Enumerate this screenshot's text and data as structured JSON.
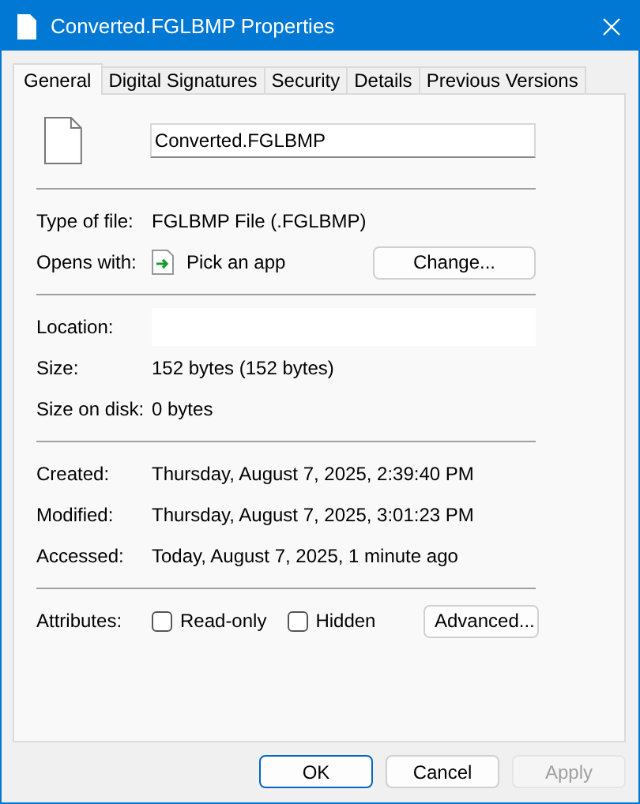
{
  "window": {
    "title": "Converted.FGLBMP Properties"
  },
  "tabs": [
    {
      "label": "General",
      "selected": true
    },
    {
      "label": "Digital Signatures",
      "selected": false
    },
    {
      "label": "Security",
      "selected": false
    },
    {
      "label": "Details",
      "selected": false
    },
    {
      "label": "Previous Versions",
      "selected": false
    }
  ],
  "file_name": "Converted.FGLBMP",
  "sections": [
    [
      {
        "kind": "text",
        "label": "Type of file:",
        "value": "FGLBMP File (.FGLBMP)"
      },
      {
        "kind": "app",
        "label": "Opens with:",
        "value": "Pick an app",
        "button": "Change..."
      }
    ],
    [
      {
        "kind": "blank",
        "label": "Location:"
      },
      {
        "kind": "text",
        "label": "Size:",
        "value": "152 bytes (152 bytes)"
      },
      {
        "kind": "text",
        "label": "Size on disk:",
        "value": "0 bytes"
      }
    ],
    [
      {
        "kind": "text",
        "label": "Created:",
        "value": "Thursday, August 7, 2025, 2:39:40 PM"
      },
      {
        "kind": "text",
        "label": "Modified:",
        "value": "Thursday, August 7, 2025, 3:01:23 PM"
      },
      {
        "kind": "text",
        "label": "Accessed:",
        "value": "Today, August 7, 2025, 1 minute ago"
      }
    ]
  ],
  "attributes": {
    "label": "Attributes:",
    "checkboxes": [
      {
        "label": "Read-only",
        "checked": false
      },
      {
        "label": "Hidden",
        "checked": false
      }
    ],
    "button": "Advanced..."
  },
  "buttons": [
    {
      "label": "OK",
      "default": true,
      "disabled": false
    },
    {
      "label": "Cancel",
      "default": false,
      "disabled": false
    },
    {
      "label": "Apply",
      "default": false,
      "disabled": true
    }
  ]
}
